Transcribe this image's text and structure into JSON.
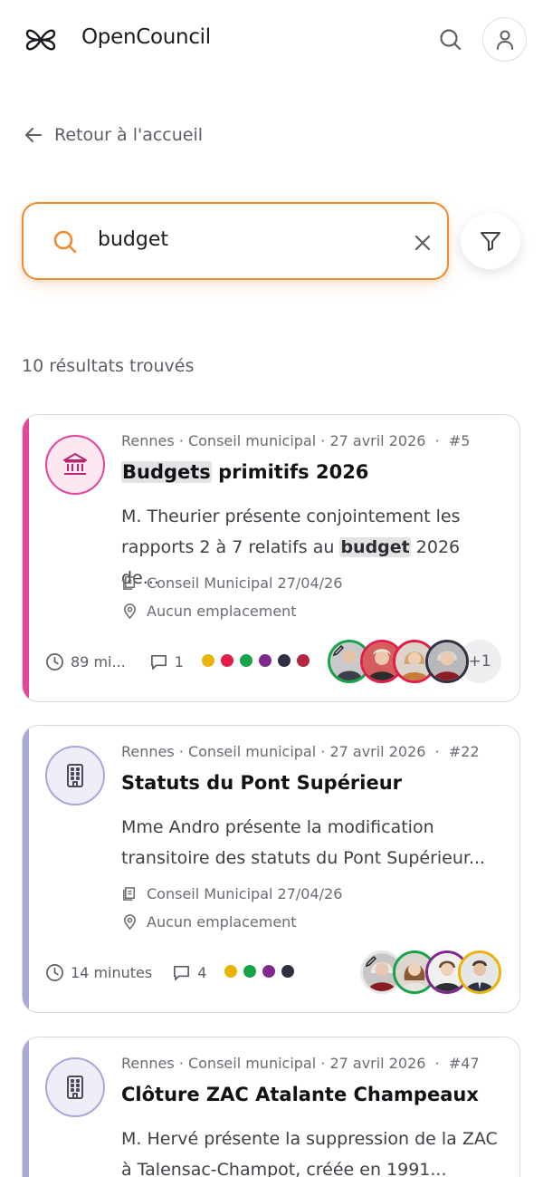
{
  "app": {
    "title": "OpenCouncil"
  },
  "nav": {
    "back_label": "Retour à l'accueil"
  },
  "search": {
    "value": "budget"
  },
  "results": {
    "count_label": "10 résultats trouvés"
  },
  "colors": {
    "accent": "#f08a2a",
    "finance_stripe": "#e4449a",
    "building_stripe": "#a9a8d6"
  },
  "cards": [
    {
      "category_icon": "bank-icon",
      "meta": "Rennes · Conseil municipal · 27 avril 2026",
      "number": "#5",
      "title_highlight": "Budgets",
      "title_rest": " primitifs 2026",
      "desc_before": "M. Theurier présente conjointement les rapports 2 à 7 relatifs au ",
      "desc_highlight": "budget",
      "desc_after": " 2026 de...",
      "meeting": "Conseil Municipal 27/04/26",
      "location": "Aucun emplacement",
      "duration": "89 mi...",
      "comments": "1",
      "dot_colors": [
        "#eab308",
        "#e11d48",
        "#16a34a",
        "#7e2a8c",
        "#2e3142",
        "#b3263f"
      ],
      "more_speakers": "+1"
    },
    {
      "category_icon": "building-icon",
      "meta": "Rennes · Conseil municipal · 27 avril 2026",
      "number": "#22",
      "title": "Statuts du Pont Supérieur",
      "description": "Mme Andro présente la modification transitoire des statuts du Pont Supérieur...",
      "meeting": "Conseil Municipal 27/04/26",
      "location": "Aucun emplacement",
      "duration": "14 minutes",
      "comments": "4",
      "dot_colors": [
        "#eab308",
        "#16a34a",
        "#7e2a8c",
        "#2e3142"
      ]
    },
    {
      "category_icon": "building-icon",
      "meta": "Rennes · Conseil municipal · 27 avril 2026",
      "number": "#47",
      "title": "Clôture ZAC Atalante Champeaux",
      "description": "M. Hervé présente la suppression de la ZAC à Talensac-Champot, créée en 1991..."
    }
  ]
}
